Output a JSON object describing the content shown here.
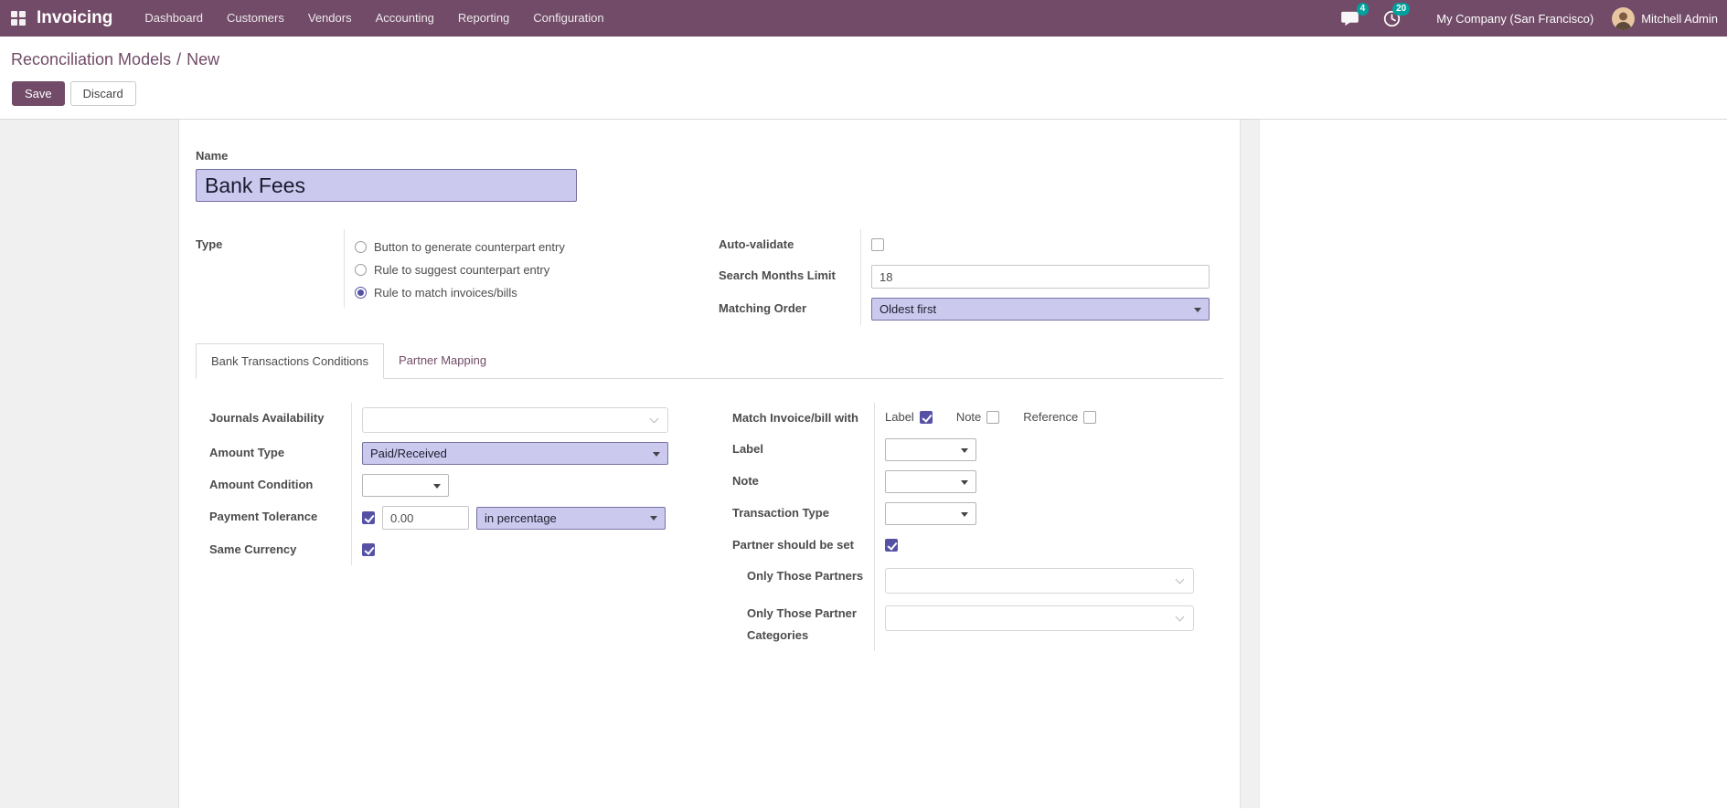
{
  "colors": {
    "accent": "#714B67",
    "badge": "#00A09D",
    "highlight": "#CCC9EF",
    "check": "#5651A5"
  },
  "navbar": {
    "app_name": "Invoicing",
    "menu_items": [
      "Dashboard",
      "Customers",
      "Vendors",
      "Accounting",
      "Reporting",
      "Configuration"
    ],
    "messages_badge": "4",
    "activities_badge": "20",
    "company_name": "My Company (San Francisco)",
    "user_name": "Mitchell Admin"
  },
  "control_panel": {
    "breadcrumb_parent": "Reconciliation Models",
    "breadcrumb_separator": "/",
    "breadcrumb_current": "New",
    "save_label": "Save",
    "discard_label": "Discard"
  },
  "form": {
    "name": {
      "label": "Name",
      "value": "Bank Fees"
    },
    "type": {
      "label": "Type",
      "options": [
        {
          "label": "Button to generate counterpart entry",
          "checked": false
        },
        {
          "label": "Rule to suggest counterpart entry",
          "checked": false
        },
        {
          "label": "Rule to match invoices/bills",
          "checked": true
        }
      ]
    },
    "auto_validate": {
      "label": "Auto-validate",
      "checked": false
    },
    "search_months_limit": {
      "label": "Search Months Limit",
      "value": "18"
    },
    "matching_order": {
      "label": "Matching Order",
      "value": "Oldest first"
    }
  },
  "tabs": [
    {
      "label": "Bank Transactions Conditions",
      "active": true
    },
    {
      "label": "Partner Mapping",
      "active": false
    }
  ],
  "conditions": {
    "journals_availability": {
      "label": "Journals Availability",
      "value": ""
    },
    "amount_type": {
      "label": "Amount Type",
      "value": "Paid/Received"
    },
    "amount_condition": {
      "label": "Amount Condition",
      "value": ""
    },
    "payment_tolerance": {
      "label": "Payment Tolerance",
      "checked": true,
      "value": "0.00",
      "unit": "in percentage"
    },
    "same_currency": {
      "label": "Same Currency",
      "checked": true
    },
    "match_with": {
      "label": "Match Invoice/bill with",
      "options": [
        {
          "label": "Label",
          "checked": true
        },
        {
          "label": "Note",
          "checked": false
        },
        {
          "label": "Reference",
          "checked": false
        }
      ]
    },
    "label_field": {
      "label": "Label",
      "value": ""
    },
    "note_field": {
      "label": "Note",
      "value": ""
    },
    "transaction_type": {
      "label": "Transaction Type",
      "value": ""
    },
    "partner_should_be_set": {
      "label": "Partner should be set",
      "checked": true
    },
    "only_those_partners": {
      "label": "Only Those Partners",
      "value": ""
    },
    "only_those_partner_categories": {
      "label": "Only Those Partner Categories",
      "value": ""
    }
  }
}
